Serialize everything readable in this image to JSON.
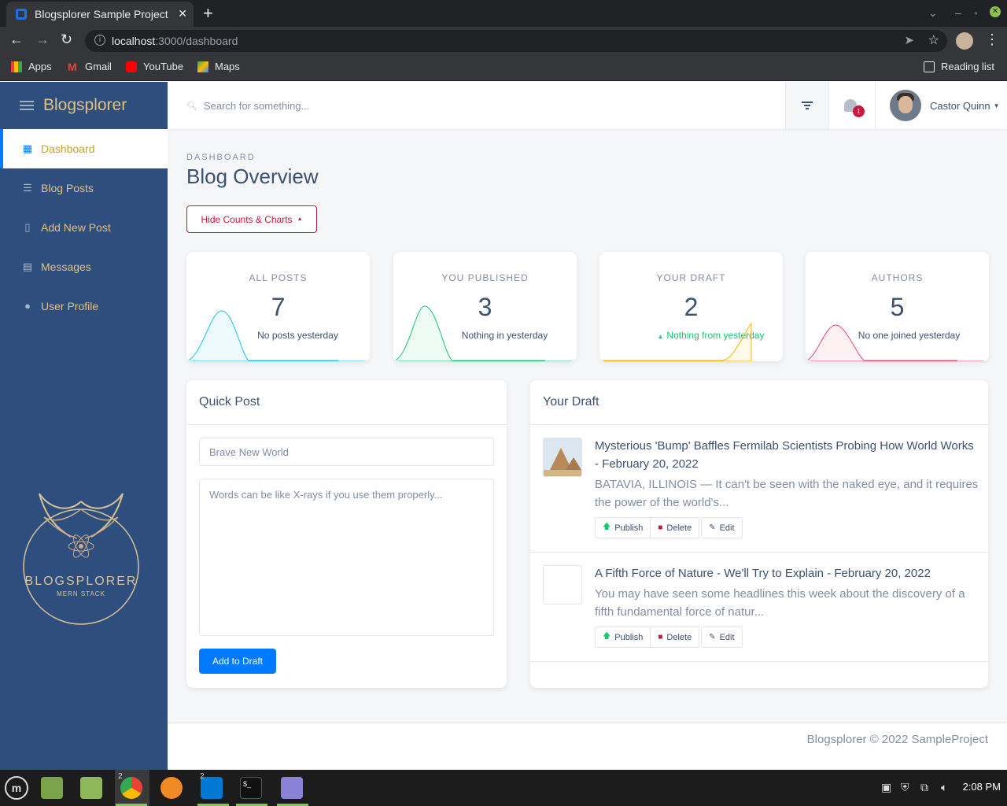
{
  "browser": {
    "tab_title": "Blogsplorer Sample Project",
    "url_host": "localhost",
    "url_path": ":3000/dashboard",
    "bookmarks": [
      "Apps",
      "Gmail",
      "YouTube",
      "Maps"
    ],
    "reading_list": "Reading list"
  },
  "sidebar": {
    "brand": "Blogsplorer",
    "items": [
      {
        "label": "Dashboard",
        "icon": "dashboard-icon"
      },
      {
        "label": "Blog Posts",
        "icon": "list-icon"
      },
      {
        "label": "Add New Post",
        "icon": "note-add-icon"
      },
      {
        "label": "Messages",
        "icon": "message-icon"
      },
      {
        "label": "User Profile",
        "icon": "person-icon"
      }
    ],
    "logo_text": "BLOGSPLORER",
    "logo_subtext": "MERN STACK"
  },
  "header": {
    "search_placeholder": "Search for something...",
    "notification_count": "1",
    "user_name": "Castor Quinn"
  },
  "page": {
    "subtitle": "DASHBOARD",
    "title": "Blog Overview",
    "toggle_button": "Hide Counts & Charts"
  },
  "stats": [
    {
      "label": "ALL POSTS",
      "value": "7",
      "note": "No posts yesterday",
      "color": "#17c6f0"
    },
    {
      "label": "YOU PUBLISHED",
      "value": "3",
      "note": "Nothing in yesterday",
      "color": "#17c671"
    },
    {
      "label": "YOUR DRAFT",
      "value": "2",
      "note": "Nothing from yesterday",
      "color": "#ffb400"
    },
    {
      "label": "AUTHORS",
      "value": "5",
      "note": "No one joined yesterday",
      "color": "#f0476a"
    }
  ],
  "quick_post": {
    "title": "Quick Post",
    "title_placeholder": "Brave New World",
    "body_placeholder": "Words can be like X-rays if you use them properly...",
    "submit": "Add to Draft"
  },
  "drafts": {
    "title": "Your Draft",
    "items": [
      {
        "title": "Mysterious 'Bump' Baffles Fermilab Scientists Probing How World Works - February 20, 2022",
        "excerpt": "BATAVIA, ILLINOIS — It can't be seen with the naked eye, and it requires the power of the world's..."
      },
      {
        "title": "A Fifth Force of Nature - We'll Try to Explain - February 20, 2022",
        "excerpt": "You may have seen some headlines this week about the discovery of a fifth fundamental force of natur..."
      }
    ],
    "actions": {
      "publish": "Publish",
      "delete": "Delete",
      "edit": "Edit"
    }
  },
  "footer": {
    "text": "Blogsplorer © 2022 SampleProject"
  },
  "taskbar": {
    "time": "2:08 PM",
    "badge_chrome": "2",
    "badge_vscode": "2"
  },
  "colors": {
    "accent": "#007bff",
    "brand_gold": "#e5c07b",
    "sidebar": "#2e4e7e",
    "danger": "#c4183c",
    "success": "#17c671"
  }
}
